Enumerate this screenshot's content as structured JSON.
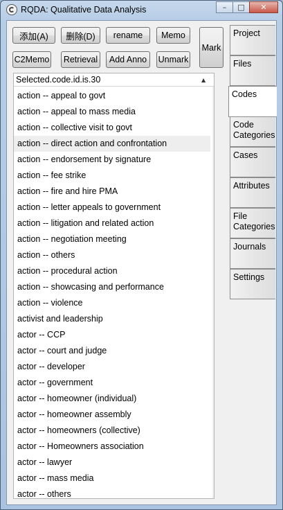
{
  "window": {
    "title": "RQDA: Qualitative Data Analysis",
    "minimize": "–",
    "maximize": "□",
    "close": "✕"
  },
  "toolbar": {
    "add": "添加(A)",
    "delete": "删除(D)",
    "rename": "rename",
    "memo": "Memo",
    "mark": "Mark",
    "c2memo": "C2Memo",
    "retrieval": "Retrieval",
    "add_anno": "Add Anno",
    "unmark": "Unmark"
  },
  "list": {
    "header": "Selected.code.id.is.30",
    "sort_icon": "▲",
    "scroll_up": "▲",
    "scroll_down": "▼",
    "items": [
      "action -- appeal to govt",
      "action -- appeal to mass media",
      "action -- collective visit to govt",
      "action -- direct action and confrontation",
      "action -- endorsement by signature",
      "action -- fee strike",
      "action -- fire and hire PMA",
      "action -- letter appeals to government",
      "action -- litigation and related action",
      "action -- negotiation meeting",
      "action -- others",
      "action -- procedural action",
      "action -- showcasing and performance",
      "action -- violence",
      "activist and leadership",
      "actor -- CCP",
      "actor -- court and judge",
      "actor -- developer",
      "actor -- government",
      "actor -- homeowner (individual)",
      "actor -- homeowner assembly",
      "actor -- homeowners (collective)",
      "actor -- Homeowners association",
      "actor -- lawyer",
      "actor -- mass media",
      "actor -- others"
    ]
  },
  "tabs": [
    {
      "label": "Project",
      "active": false
    },
    {
      "label": "Files",
      "active": false
    },
    {
      "label": "Codes",
      "active": true
    },
    {
      "label": "Code Categories",
      "active": false
    },
    {
      "label": "Cases",
      "active": false
    },
    {
      "label": "Attributes",
      "active": false
    },
    {
      "label": "File Categories",
      "active": false
    },
    {
      "label": "Journals",
      "active": false
    },
    {
      "label": "Settings",
      "active": false
    }
  ]
}
